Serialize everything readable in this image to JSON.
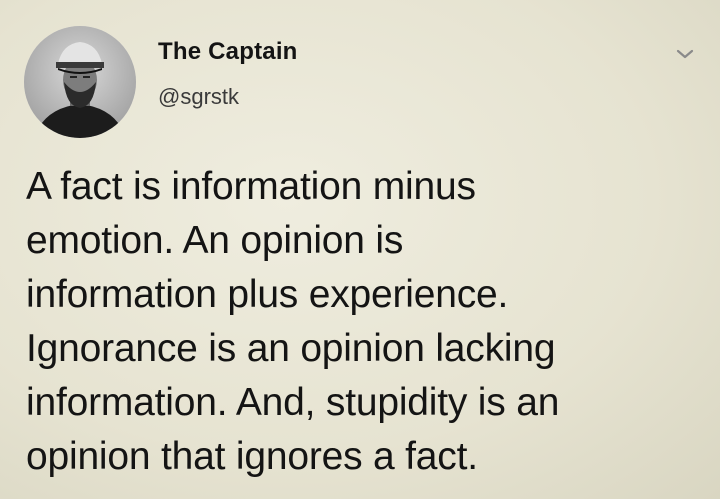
{
  "tweet": {
    "author": {
      "display_name": "The Captain",
      "handle": "@sgrstk",
      "avatar_icon": "avatar-portrait"
    },
    "menu_icon": "chevron-down-icon",
    "text": "A fact is information minus\nemotion. An opinion is\ninformation plus experience.\nIgnorance is an opinion lacking\ninformation. And, stupidity is an\nopinion that ignores a fact."
  },
  "colors": {
    "background": "#e9e6d6",
    "text": "#141414",
    "handle": "#3a3a3a"
  }
}
